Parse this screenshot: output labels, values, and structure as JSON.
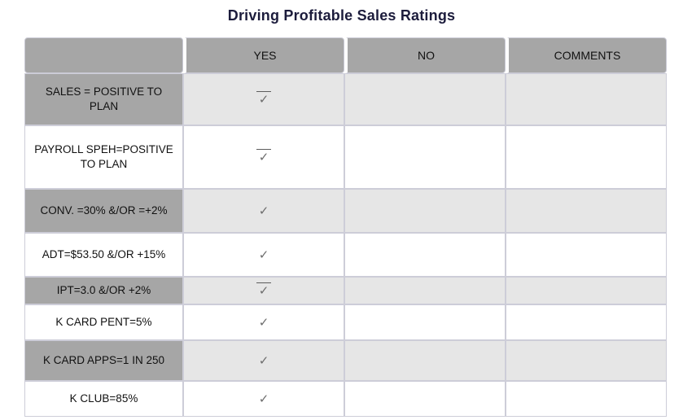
{
  "title": "Driving Profitable Sales Ratings",
  "colors": {
    "title_text": "#1c1c3c",
    "header_bg": "#a6a6a6",
    "label_bg": "#a6a6a6",
    "row_shade_bg": "#e6e6e6",
    "row_plain_bg": "#ffffff",
    "border": "#cdcdd8",
    "check_color": "#6d6d6d"
  },
  "table": {
    "columns": [
      {
        "key": "metric",
        "label": ""
      },
      {
        "key": "yes",
        "label": "YES"
      },
      {
        "key": "no",
        "label": "NO"
      },
      {
        "key": "comments",
        "label": "COMMENTS"
      }
    ],
    "rows": [
      {
        "metric": "SALES = POSITIVE TO PLAN",
        "yes": "check-barred-icon",
        "yes_mark": "✓",
        "no": "",
        "comments": ""
      },
      {
        "metric": "PAYROLL SPEH=POSITIVE TO PLAN",
        "yes": "check-barred-icon",
        "yes_mark": "✓",
        "no": "",
        "comments": ""
      },
      {
        "metric": "CONV. =30% &/OR =+2%",
        "yes": "check-icon",
        "yes_mark": "✓",
        "no": "",
        "comments": ""
      },
      {
        "metric": "ADT=$53.50 &/OR +15%",
        "yes": "check-icon",
        "yes_mark": "✓",
        "no": "",
        "comments": ""
      },
      {
        "metric": "IPT=3.0 &/OR +2%",
        "yes": "check-barred-icon",
        "yes_mark": "✓",
        "no": "",
        "comments": ""
      },
      {
        "metric": "K CARD PENT=5%",
        "yes": "check-icon",
        "yes_mark": "✓",
        "no": "",
        "comments": ""
      },
      {
        "metric": "K CARD APPS=1 IN 250",
        "yes": "check-icon",
        "yes_mark": "✓",
        "no": "",
        "comments": ""
      },
      {
        "metric": "K CLUB=85%",
        "yes": "check-icon",
        "yes_mark": "✓",
        "no": "",
        "comments": ""
      }
    ]
  }
}
